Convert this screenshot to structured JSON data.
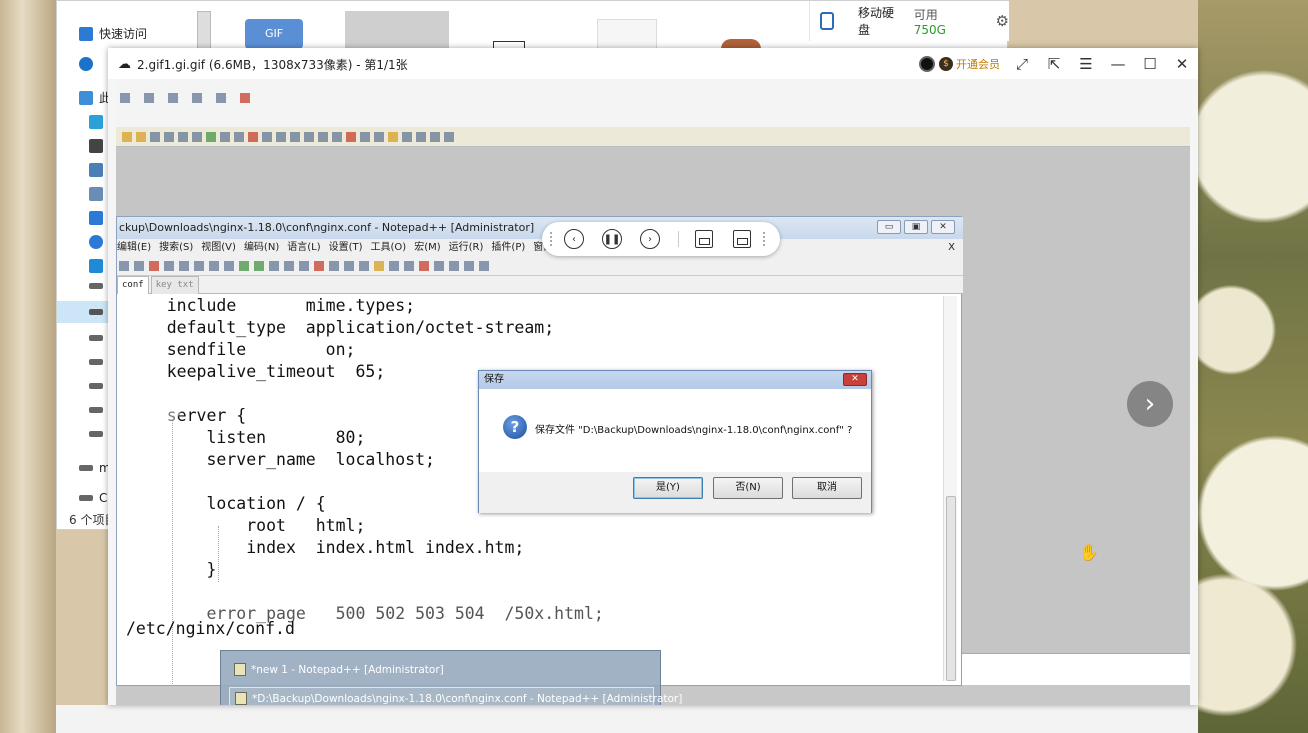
{
  "explorer": {
    "nav_items": [
      {
        "label": "快速访问",
        "icon": "star-icon"
      },
      {
        "label": "",
        "icon": "onedrive-icon"
      },
      {
        "label": "此",
        "icon": "this-pc-icon"
      }
    ],
    "drive_label": "移动硬盘",
    "free_prefix": "可用",
    "free_value": "750G",
    "partial_items": [
      "m",
      "C"
    ],
    "status": "6 个项目"
  },
  "viewer": {
    "title": "2.gif1.gi.gif (6.6MB，1308x733像素) - 第1/1张",
    "vip_label": "开通会员",
    "controls": {
      "prev": "prev-icon",
      "pause": "pause-icon",
      "next": "next-icon"
    }
  },
  "npp": {
    "title": "ckup\\Downloads\\nginx-1.18.0\\conf\\nginx.conf - Notepad++ [Administrator]",
    "menu": [
      "编辑(E)",
      "搜索(S)",
      "视图(V)",
      "编码(N)",
      "语言(L)",
      "设置(T)",
      "工具(O)",
      "宏(M)",
      "运行(R)",
      "插件(P)",
      "窗口(W)",
      "?"
    ],
    "menu_close": "X",
    "tabs": [
      {
        "label": "conf",
        "active": true
      },
      {
        "label": "key txt",
        "active": false
      }
    ],
    "code_lines": [
      "    include       mime.types;",
      "    default_type  application/octet-stream;",
      "    sendfile        on;",
      "    keepalive_timeout  65;",
      "",
      "    server {",
      "        listen       80;",
      "        server_name  localhost;",
      "",
      "        location / {",
      "            root   html;",
      "            index  index.html index.htm;",
      "        }",
      "",
      "        error_page   500 502 503 504  /50x.html;"
    ],
    "path_overlay": "/etc/nginx/conf.d"
  },
  "dialog": {
    "title": "保存",
    "message": "保存文件 \"D:\\Backup\\Downloads\\nginx-1.18.0\\conf\\nginx.conf\" ?",
    "yes": "是(Y)",
    "no": "否(N)",
    "cancel": "取消"
  },
  "jumplist": [
    {
      "label": "*new 1 - Notepad++ [Administrator]",
      "selected": false
    },
    {
      "label": "*D:\\Backup\\Downloads\\nginx-1.18.0\\conf\\nginx.conf - Notepad++ [Administrator]",
      "selected": true
    }
  ],
  "colors": {
    "accent": "#2a9b2a",
    "vip": "#c07a00",
    "dialog_border": "#6b89b6"
  }
}
